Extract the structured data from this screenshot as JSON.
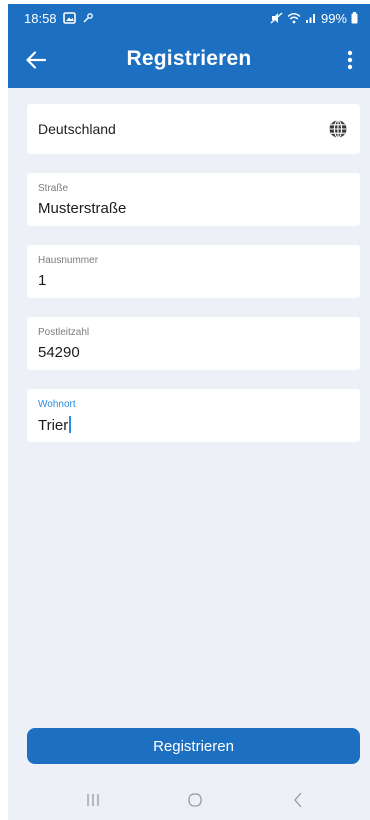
{
  "status_bar": {
    "time": "18:58",
    "battery": "99%"
  },
  "app_bar": {
    "title": "Registrieren"
  },
  "form": {
    "country": "Deutschland",
    "fields": [
      {
        "label": "Straße",
        "value": "Musterstraße"
      },
      {
        "label": "Hausnummer",
        "value": "1"
      },
      {
        "label": "Postleitzahl",
        "value": "54290"
      },
      {
        "label": "Wohnort",
        "value": "Trier"
      }
    ]
  },
  "submit_label": "Registrieren",
  "colors": {
    "primary": "#1c6fc1",
    "background": "#edf0f6",
    "focus": "#2a8ee0"
  }
}
